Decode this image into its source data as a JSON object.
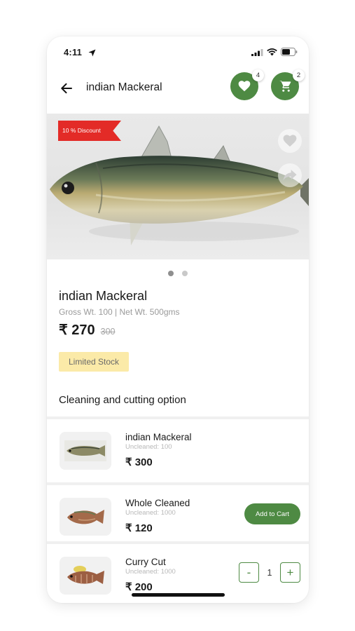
{
  "status_bar": {
    "time": "4:11"
  },
  "header": {
    "title": "indian Mackeral",
    "wishlist_count": "4",
    "cart_count": "2"
  },
  "product": {
    "discount_label": "10 % Discount",
    "name": "indian Mackeral",
    "weights": "Gross Wt. 100 | Net Wt. 500gms",
    "price": "₹ 270",
    "mrp": "300",
    "stock_label": "Limited Stock",
    "image_count": 2,
    "active_image": 1
  },
  "options_section": {
    "title": "Cleaning and cutting option"
  },
  "options": [
    {
      "name": "indian Mackeral",
      "sub": "Uncleaned: 100",
      "price": "₹ 300"
    },
    {
      "name": "Whole Cleaned",
      "sub": "Uncleaned: 1000",
      "price": "₹ 120",
      "action_label": "Add to Cart"
    },
    {
      "name": "Curry Cut",
      "sub": "Uncleaned: 1000",
      "price": "₹ 200",
      "minus": "-",
      "quantity": "1",
      "plus": "+"
    }
  ],
  "colors": {
    "brand_green": "#4e8a43",
    "discount_red": "#e32b27",
    "stock_yellow": "#fbeaa8"
  }
}
